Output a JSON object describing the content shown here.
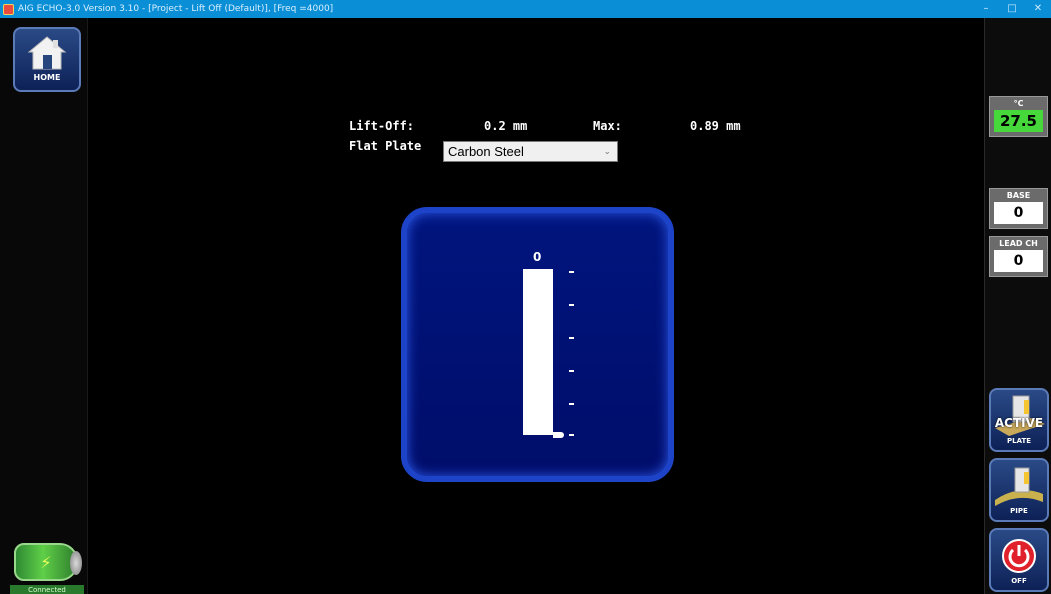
{
  "window": {
    "title": "AIG ECHO-3.0 Version 3.10 - [Project - Lift Off (Default)], [Freq =4000]",
    "minimize": "–",
    "maximize": "□",
    "close": "✕"
  },
  "left_rail": {
    "home_label": "HOME",
    "connection_status": "Connected"
  },
  "main": {
    "liftoff_label": "Lift-Off:",
    "liftoff_value": "0.2 mm",
    "max_label": "Max:",
    "max_value": "0.89 mm",
    "surface_label": "Flat Plate",
    "material_selected": "Carbon Steel",
    "gauge_top_label": "0",
    "gauge_fill_fraction": 1.0
  },
  "right_rail": {
    "temp_label": "°C",
    "temp_value": "27.5",
    "base_label": "BASE",
    "base_value": "0",
    "lead_label": "LEAD CH",
    "lead_value": "0",
    "plate_active_text": "ACTIVE",
    "plate_label": "PLATE",
    "pipe_label": "PIPE",
    "off_label": "OFF"
  },
  "colors": {
    "titlebar": "#0a8fd6",
    "panel_blue": "#00157e",
    "temp_green": "#46d83a",
    "off_red": "#e0202a"
  }
}
